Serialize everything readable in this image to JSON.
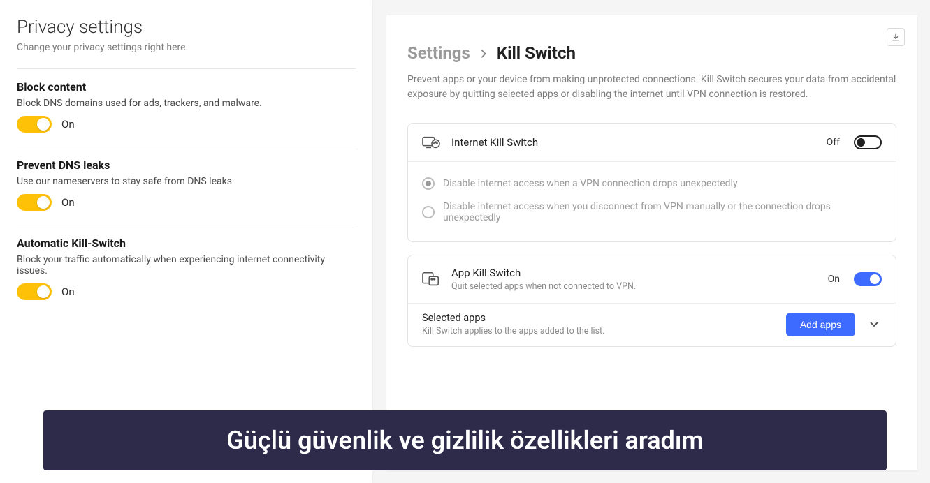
{
  "left": {
    "title": "Privacy settings",
    "subtitle": "Change your privacy settings right here.",
    "items": [
      {
        "title": "Block content",
        "desc": "Block DNS domains used for ads, trackers, and malware.",
        "state": "On"
      },
      {
        "title": "Prevent DNS leaks",
        "desc": "Use our nameservers to stay safe from DNS leaks.",
        "state": "On"
      },
      {
        "title": "Automatic Kill-Switch",
        "desc": "Block your traffic automatically when experiencing internet connectivity issues.",
        "state": "On"
      }
    ]
  },
  "right": {
    "breadcrumb_root": "Settings",
    "breadcrumb_current": "Kill Switch",
    "description": "Prevent apps or your device from making unprotected connections. Kill Switch secures your data from accidental exposure by quitting selected apps or disabling the internet until VPN connection is restored.",
    "internet_ks": {
      "title": "Internet Kill Switch",
      "state": "Off",
      "options": [
        "Disable internet access when a VPN connection drops unexpectedly",
        "Disable internet access when you disconnect from VPN manually or the connection drops unexpectedly"
      ]
    },
    "app_ks": {
      "title": "App Kill Switch",
      "subtext": "Quit selected apps when not connected to VPN.",
      "state": "On"
    },
    "selected_apps": {
      "title": "Selected apps",
      "subtext": "Kill Switch applies to the apps added to the list.",
      "button": "Add apps"
    }
  },
  "caption": "Güçlü güvenlik ve gizlilik özellikleri aradım"
}
